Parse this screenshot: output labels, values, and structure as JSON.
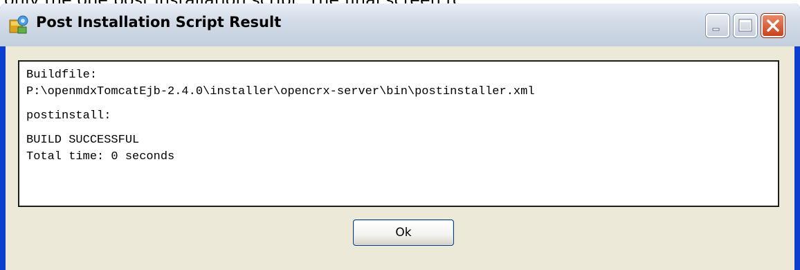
{
  "background": {
    "partial_text": "only the one post installation script. The final screen [c"
  },
  "window": {
    "title": "Post Installation Script Result",
    "icon": "setup-package-icon",
    "controls": {
      "minimize": "minimize-icon",
      "maximize": "maximize-icon",
      "close": "close-icon"
    }
  },
  "output": {
    "lines": [
      "Buildfile:",
      "P:\\openmdxTomcatEjb-2.4.0\\installer\\opencrx-server\\bin\\postinstaller.xml",
      "",
      "postinstall:",
      "",
      "BUILD SUCCESSFUL",
      "Total time: 0 seconds"
    ]
  },
  "buttons": {
    "ok_label": "Ok"
  },
  "colors": {
    "titlebar": "#d3dce8",
    "client": "#ece9d8",
    "close_button": "#c9421a",
    "window_border": "#0a3fd0"
  }
}
